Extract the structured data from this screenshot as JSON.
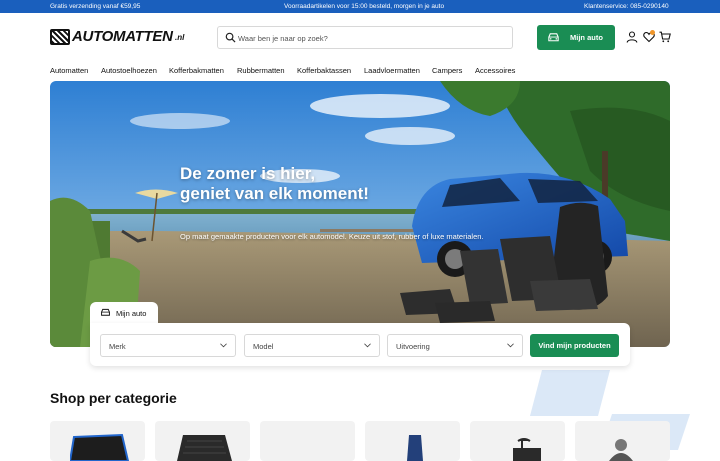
{
  "topbar": {
    "shipping": "Gratis verzending vanaf €59,95",
    "delivery": "Voorraadartikelen voor 15:00 besteld, morgen in je auto",
    "service": "Klantenservice: 085-0290140"
  },
  "header": {
    "logo_text": "AUTOMATTEN",
    "logo_tld": ".nl",
    "search_placeholder": "Waar ben je naar op zoek?",
    "mijn_auto": "Mijn auto",
    "icons": [
      "user-icon",
      "heart-icon",
      "cart-icon"
    ]
  },
  "nav": {
    "items": [
      "Automatten",
      "Autostoelhoezen",
      "Kofferbakmatten",
      "Rubbermatten",
      "Kofferbaktassen",
      "Laadvloermatten",
      "Campers",
      "Accessoires"
    ]
  },
  "hero": {
    "title_line1": "De zomer is hier,",
    "title_line2": "geniet van elk moment!",
    "subtitle": "Op maat gemaakte producten voor elk automodel. Keuze uit stof, rubber of luxe materialen."
  },
  "finder": {
    "tab_label": "Mijn auto",
    "merk": "Merk",
    "model": "Model",
    "uitvoering": "Uitvoering",
    "button": "Vind mijn producten"
  },
  "categories": {
    "title": "Shop per categorie"
  },
  "colors": {
    "brand_blue": "#1a5fbd",
    "cta_green": "#1a8d54",
    "badge_orange": "#f0962a"
  }
}
